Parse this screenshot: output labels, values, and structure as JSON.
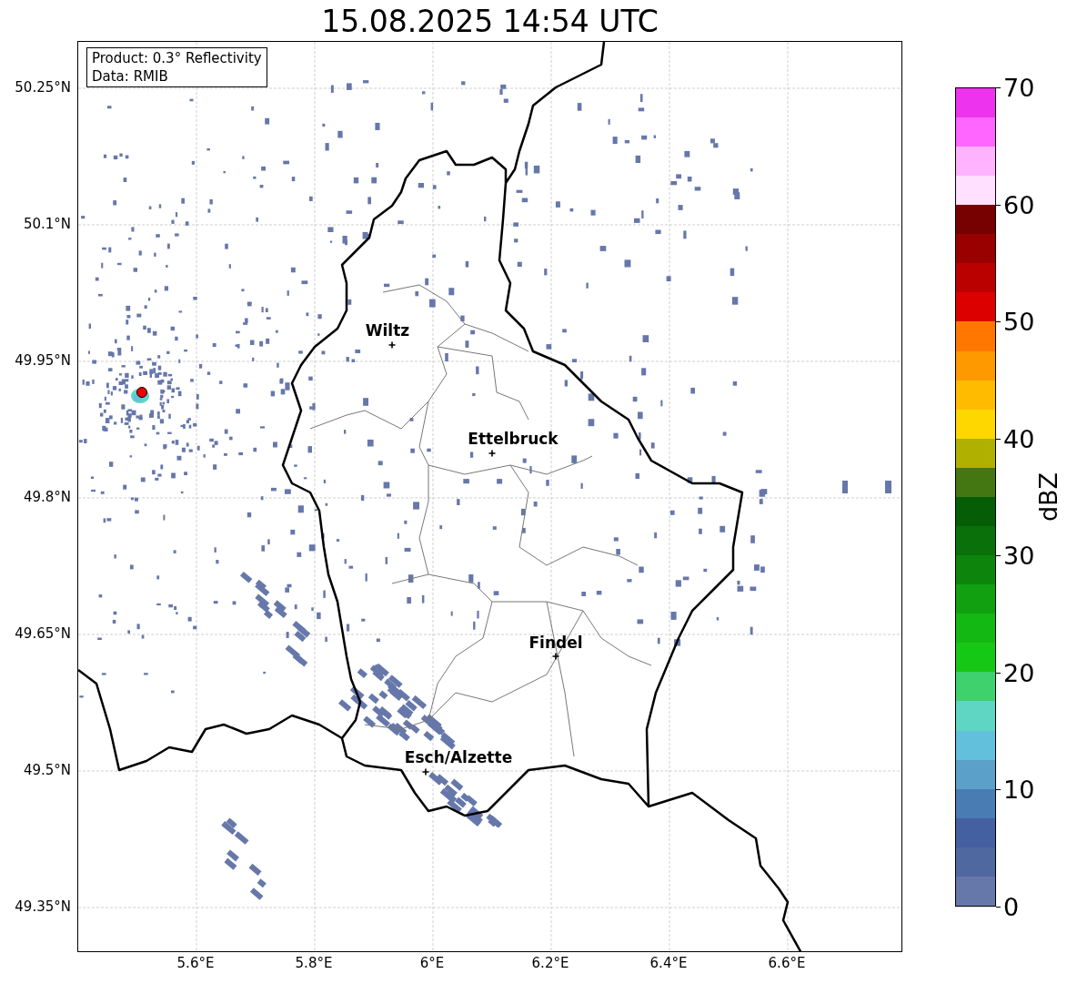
{
  "title": "15.08.2025 14:54 UTC",
  "map": {
    "info_box": [
      "Product: 0.3° Reflectivity",
      "Data: RMIB"
    ],
    "lat_ticks": [
      "50.25°N",
      "50.1°N",
      "49.95°N",
      "49.8°N",
      "49.65°N",
      "49.5°N",
      "49.35°N"
    ],
    "lon_ticks": [
      "5.6°E",
      "5.8°E",
      "6°E",
      "6.2°E",
      "6.4°E",
      "6.6°E"
    ],
    "cities": [
      {
        "name": "Wiltz"
      },
      {
        "name": "Ettelbruck"
      },
      {
        "name": "Findel"
      },
      {
        "name": "Esch/Alzette"
      }
    ]
  },
  "colorbar": {
    "label": "dBZ",
    "ticks": [
      "70",
      "60",
      "50",
      "40",
      "30",
      "20",
      "10",
      "0"
    ],
    "bins": [
      {
        "color": "#6677aa"
      },
      {
        "color": "#5068a0"
      },
      {
        "color": "#4460a0"
      },
      {
        "color": "#4a7cb4"
      },
      {
        "color": "#5aa0c8"
      },
      {
        "color": "#63c0dc"
      },
      {
        "color": "#5fd6c3"
      },
      {
        "color": "#3ed16d"
      },
      {
        "color": "#15c815"
      },
      {
        "color": "#13b813"
      },
      {
        "color": "#10a010"
      },
      {
        "color": "#0d850d"
      },
      {
        "color": "#0a700a"
      },
      {
        "color": "#055d05"
      },
      {
        "color": "#447711"
      },
      {
        "color": "#b0b000"
      },
      {
        "color": "#ffd700"
      },
      {
        "color": "#ffbb00"
      },
      {
        "color": "#ff9900"
      },
      {
        "color": "#ff7700"
      },
      {
        "color": "#dd0000"
      },
      {
        "color": "#bb0000"
      },
      {
        "color": "#990000"
      },
      {
        "color": "#770000"
      },
      {
        "color": "#ffe0ff"
      },
      {
        "color": "#ffb3ff"
      },
      {
        "color": "#ff66ff"
      },
      {
        "color": "#ee33ee"
      }
    ]
  }
}
